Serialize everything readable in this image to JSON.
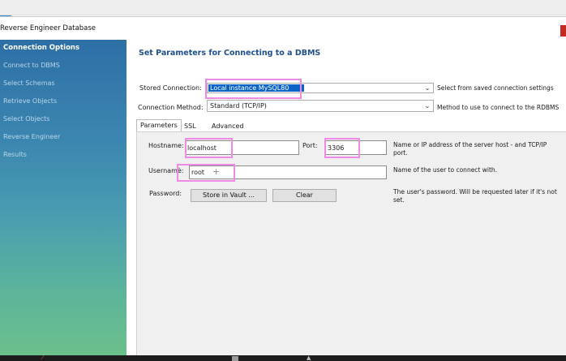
{
  "window": {
    "title": "Reverse Engineer Database"
  },
  "sidebar": {
    "items": [
      {
        "label": "Connection Options",
        "active": true
      },
      {
        "label": "Connect to DBMS",
        "active": false
      },
      {
        "label": "Select Schemas",
        "active": false
      },
      {
        "label": "Retrieve Objects",
        "active": false
      },
      {
        "label": "Select Objects",
        "active": false
      },
      {
        "label": "Reverse Engineer",
        "active": false
      },
      {
        "label": "Results",
        "active": false
      }
    ]
  },
  "main": {
    "heading": "Set Parameters for Connecting to a DBMS",
    "stored_connection": {
      "label": "Stored Connection:",
      "value": "Local instance MySQL80",
      "help": "Select from saved connection settings"
    },
    "connection_method": {
      "label": "Connection Method:",
      "value": "Standard (TCP/IP)",
      "help": "Method to use to connect to the RDBMS"
    },
    "tabs": [
      {
        "label": "Parameters",
        "active": true
      },
      {
        "label": "SSL",
        "active": false
      },
      {
        "label": "Advanced",
        "active": false
      }
    ],
    "parameters": {
      "hostname": {
        "label": "Hostname:",
        "value": "localhost"
      },
      "port": {
        "label": "Port:",
        "value": "3306",
        "help": "Name or IP address of the server host - and TCP/IP port."
      },
      "username": {
        "label": "Usernamè:",
        "value": "root",
        "help": "Name of the user to connect with."
      },
      "password": {
        "label": "Password:",
        "store_button": "Store in Vault ...",
        "clear_button": "Clear",
        "help": "The user's password. Will be requested later if it's not set."
      }
    }
  },
  "colors": {
    "accent": "#0a64c8",
    "heading": "#1f4f8c",
    "highlight": "#f08ae8",
    "sidebar_top": "#2d6fa6",
    "sidebar_bottom": "#6cc08c"
  },
  "icons": [
    "close-icon",
    "dropdown-arrow-icon",
    "cursor-cross-icon"
  ]
}
